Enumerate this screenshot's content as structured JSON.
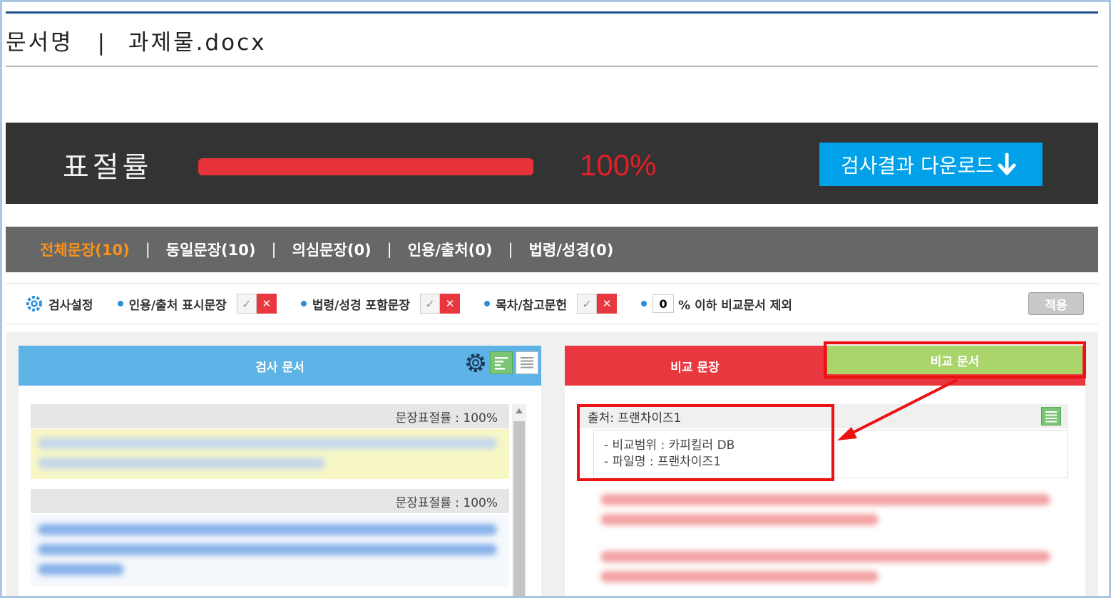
{
  "header": {
    "doc_label": "문서명",
    "separator": "|",
    "doc_name": "과제물.docx"
  },
  "summary": {
    "label": "표절률",
    "percent_text": "100%",
    "progress_fraction": 1.0,
    "download_label": "검사결과 다운로드",
    "download_icon": "arrow-down-icon"
  },
  "tabs": [
    {
      "label": "전체문장(10)",
      "active": true
    },
    {
      "label": "동일문장(10)",
      "active": false
    },
    {
      "label": "의심문장(0)",
      "active": false
    },
    {
      "label": "인용/출처(0)",
      "active": false
    },
    {
      "label": "법령/성경(0)",
      "active": false
    }
  ],
  "tab_separator": "|",
  "settings": {
    "title": "검사설정",
    "item1": "인용/출처 표시문장",
    "item2": "법령/성경 포함문장",
    "item3": "목차/참고문헌",
    "threshold_value": "0",
    "threshold_label": "% 이하 비교문서 제외",
    "apply_label": "적용"
  },
  "left_panel": {
    "title": "검사 문서",
    "sentence_rate_1": "문장표절률 : 100%",
    "sentence_rate_2": "문장표절률 : 100%"
  },
  "right_panel": {
    "tab_compare_sentence": "비교 문장",
    "tab_compare_doc": "비교 문서",
    "source_label": "출처: 프랜차이즈1",
    "compare_range": "- 비교범위 : 카피킬러 DB",
    "file_name": "- 파일명 : 프랜차이즈1"
  },
  "colors": {
    "accent_red": "#e8373e",
    "accent_blue": "#5db3e6",
    "download_blue": "#00a1e9",
    "active_tab_orange": "#f7941d",
    "green": "#a9d56b",
    "highlight_yellow": "#f7f7c6"
  }
}
